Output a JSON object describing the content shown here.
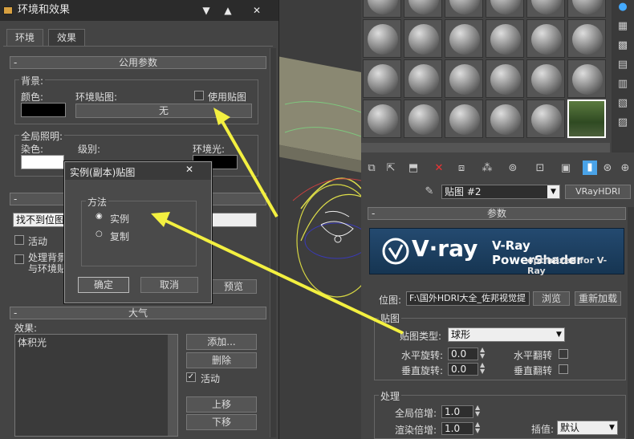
{
  "env_dialog": {
    "title": "环境和效果",
    "tabs": [
      "环境",
      "效果"
    ],
    "common_params": "公用参数",
    "background_label": "背景:",
    "color_label": "颜色:",
    "env_map_label": "环境贴图:",
    "use_map_label": "使用贴图",
    "env_map_value": "无",
    "global_illum": "全局照明:",
    "tint_label": "染色:",
    "level_label": "级别:",
    "ambient_label": "环境光:",
    "missing_map_field": "找不到位图",
    "active_label": "活动",
    "process_bg_label": "处理背景",
    "and_env_label": "与环境贴",
    "preview_btn": "预览",
    "atmosphere_header": "大气",
    "effects_label": "效果:",
    "effects_items": [
      "体积光"
    ],
    "add_btn": "添加...",
    "delete_btn": "删除",
    "active2_label": "活动",
    "move_up_btn": "上移",
    "move_down_btn": "下移"
  },
  "popup": {
    "title": "实例(副本)贴图",
    "method_label": "方法",
    "option_instance": "实例",
    "option_copy": "复制",
    "ok_btn": "确定",
    "cancel_btn": "取消"
  },
  "material_editor": {
    "map_name": "贴图 #2",
    "map_type_btn": "VRayHDRI",
    "params_header": "参数",
    "banner_logo": "V·ray",
    "banner_title": "V-Ray PowerShader",
    "banner_sub": "optimized for V-Ray",
    "bitmap_label": "位图:",
    "bitmap_path": "F:\\国外HDRI大全_佐邦视觉提",
    "browse_btn": "浏览",
    "reload_btn": "重新加载",
    "mapping_group": "贴图",
    "map_type_label": "贴图类型:",
    "map_type_value": "球形",
    "h_rot_label": "水平旋转:",
    "h_rot_value": "0.0",
    "v_rot_label": "垂直旋转:",
    "v_rot_value": "0.0",
    "h_flip_label": "水平翻转",
    "v_flip_label": "垂直翻转",
    "processing_group": "处理",
    "overall_mult_label": "全局倍增:",
    "overall_mult_value": "1.0",
    "render_mult_label": "渲染倍增:",
    "render_mult_value": "1.0",
    "interp_label": "插值:",
    "interp_value": "默认"
  },
  "colors": {
    "accent_arrow": "#f3f040",
    "vray_blue": "#1d3f60"
  }
}
